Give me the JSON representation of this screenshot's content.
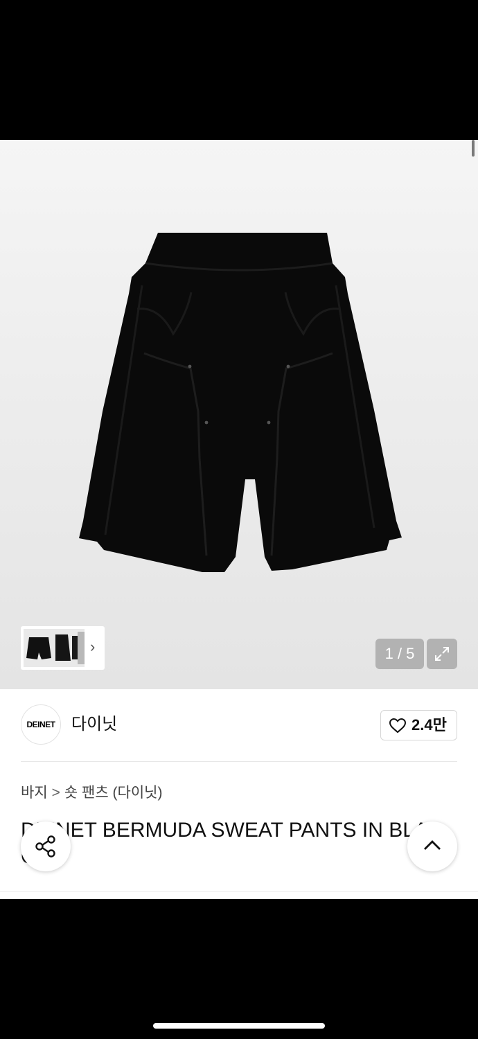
{
  "gallery": {
    "counter": "1 / 5",
    "thumb_chevron": "›",
    "icons": {
      "expand": "expand-arrows-icon",
      "chevron": "chevron-right-icon"
    }
  },
  "brand": {
    "logo_text": "DEINET",
    "name": "다이닛",
    "like_count": "2.4만",
    "like_icon": "heart-outline-icon"
  },
  "breadcrumb": {
    "category": "바지",
    "separator": ">",
    "subcategory": "숏 팬츠 (다이닛)"
  },
  "product": {
    "title_line1": "DEINET BERMUDA SWEAT PANTS IN BLA",
    "title_line2": "CK"
  },
  "floating": {
    "share_icon": "share-icon",
    "top_icon": "chevron-up-icon"
  },
  "colors": {
    "accent": "#000000",
    "counter_bg": "#969696"
  }
}
